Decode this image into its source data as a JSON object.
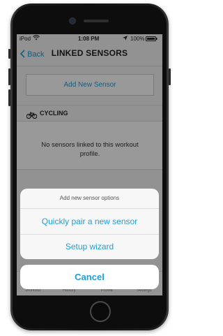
{
  "status_bar": {
    "carrier": "iPod",
    "time": "1:08 PM",
    "battery": "100%"
  },
  "nav": {
    "back_label": "Back",
    "title": "LINKED SENSORS"
  },
  "add_sensor": {
    "label": "Add New Sensor"
  },
  "section": {
    "title": "CYCLING",
    "icon": "bicycle-icon"
  },
  "empty_state": {
    "message": "No sensors linked to this workout profile."
  },
  "tabbar": {
    "items": [
      {
        "label": "Workout"
      },
      {
        "label": "History"
      },
      {
        "label": "Profile"
      },
      {
        "label": "Settings"
      }
    ]
  },
  "action_sheet": {
    "title": "Add new sensor options",
    "options": [
      {
        "label": "Quickly pair a new sensor"
      },
      {
        "label": "Setup wizard"
      }
    ],
    "cancel_label": "Cancel"
  },
  "colors": {
    "accent": "#1a9fd8",
    "overlay": "#000000"
  }
}
